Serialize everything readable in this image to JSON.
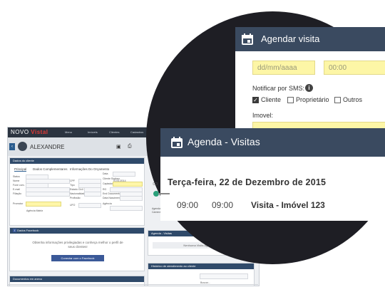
{
  "crm": {
    "brand_prefix": "NOVO",
    "brand_name": "Vistal",
    "nav": [
      "Menu",
      "Imóveis",
      "Clientes",
      "Cadastros"
    ],
    "client_name": "ALEXANDRE",
    "panel_dados": "Dados do cliente",
    "tabs": [
      "Principal",
      "Dados Complementares",
      "Informações Do Orçamento"
    ],
    "fields": {
      "status": "Status",
      "status_value": "ATIVO",
      "nome": "Nome",
      "nome_value": "ALEXANDRE",
      "fone_com": "Fone com.",
      "fone_value": "11 99 99 9999",
      "email": "E-mail",
      "filiacao": "Filiação",
      "promotor": "Promotor",
      "promotor_value": "Agência Matriz",
      "data": "Data",
      "data_value": "01/01/2014",
      "cpf": "CPF",
      "cliente_sigilo": "Cliente Sigiloso",
      "captador": "Captador",
      "tipo": "Tipo",
      "estado_civil": "Estado Civil",
      "nacionalidade": "Nacionalidade",
      "profissao": "Profissão",
      "rg": "RG",
      "end_documento": "End Documento",
      "data_nascimento": "Data Nascimento",
      "agencia": "Agência",
      "ufo": "UFO"
    },
    "panel_facebook": "Dados Facebook",
    "facebook_text": "Obtenha informações privilegiadas e conheça melhor o perfil de seus clientes!",
    "facebook_button": "Conectar com o Facebook",
    "panel_documentos": "Documentos em anexo",
    "side_agenda_label": "Agendamento de visita",
    "side_agenda_text": "Camera visitar os imóveis",
    "side_panel_agenda": "Agenda - Visitas",
    "side_no_visit": "Nenhuma Visita Agendada",
    "side_panel_hist": "Histórico de atendimento ao cliente",
    "side_search": "Buscar..."
  },
  "agendar": {
    "title": "Agendar visita",
    "date_placeholder": "dd/mm/aaaa",
    "time_placeholder": "00:00",
    "notify_label": "Notificar por SMS:",
    "options": [
      {
        "label": "Cliente",
        "checked": true
      },
      {
        "label": "Proprietário",
        "checked": false
      },
      {
        "label": "Outros",
        "checked": false
      }
    ],
    "imovel_label": "Imovel:"
  },
  "agenda": {
    "title": "Agenda - Visitas",
    "date": "Terça-feira, 22 de Dezembro de 2015",
    "time_start": "09:00",
    "time_end": "09:00",
    "visit_label": "Visita - Imóvel 123"
  },
  "colors": {
    "navy": "#3a4a60",
    "dark": "#1e1e24",
    "yellow_field": "#fdf6a6",
    "facebook": "#3b5998",
    "brand_red": "#e53935"
  }
}
